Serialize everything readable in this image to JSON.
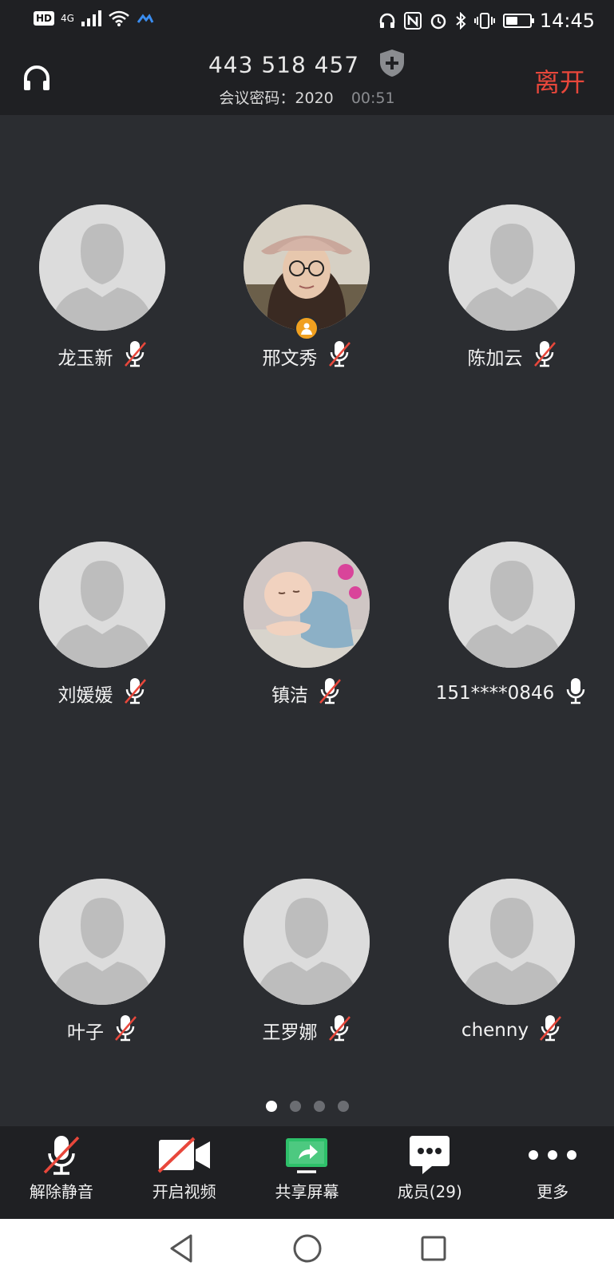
{
  "status_bar": {
    "left": [
      "HD",
      "4G"
    ],
    "time": "14:45",
    "battery_level": 0.5
  },
  "header": {
    "meeting_id": "443 518 457",
    "password_label": "会议密码：2020",
    "timer": "00:51",
    "leave_label": "离开"
  },
  "participants": [
    {
      "name": "龙玉新",
      "mic": "muted",
      "avatar": "default"
    },
    {
      "name": "邢文秀",
      "mic": "muted",
      "avatar": "photo-woman",
      "host": true
    },
    {
      "name": "陈加云",
      "mic": "muted",
      "avatar": "default"
    },
    {
      "name": "刘媛媛",
      "mic": "muted",
      "avatar": "default"
    },
    {
      "name": "镇洁",
      "mic": "muted",
      "avatar": "photo-baby"
    },
    {
      "name": "151****0846",
      "mic": "on",
      "avatar": "default"
    },
    {
      "name": "叶子",
      "mic": "muted",
      "avatar": "default"
    },
    {
      "name": "王罗娜",
      "mic": "muted",
      "avatar": "default"
    },
    {
      "name": "chenny",
      "mic": "muted",
      "avatar": "default"
    }
  ],
  "pagination": {
    "total": 4,
    "current": 1
  },
  "toolbar": {
    "unmute_label": "解除静音",
    "video_label": "开启视频",
    "share_label": "共享屏幕",
    "members_label": "成员(29)",
    "more_label": "更多"
  },
  "colors": {
    "leave": "#e8473b",
    "host_badge": "#f0a020",
    "share_green": "#2ec06a",
    "mute_red": "#e8473b"
  }
}
